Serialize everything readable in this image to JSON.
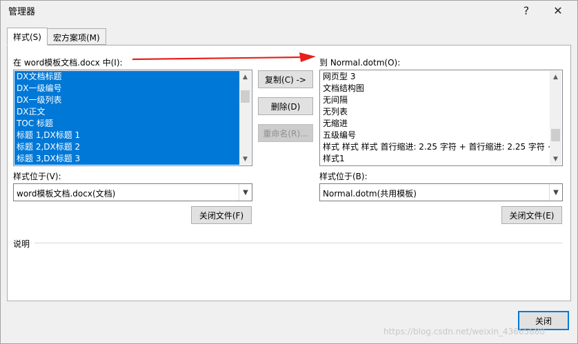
{
  "dialog": {
    "title": "管理器",
    "help": "?",
    "close": "✕"
  },
  "tabs": [
    {
      "label": "样式(S)"
    },
    {
      "label": "宏方案项(M)"
    }
  ],
  "left": {
    "from_label": "在 word模板文档.docx 中(I):",
    "items": [
      "DX文档标题",
      "DX一级编号",
      "DX一级列表",
      "DX正文",
      "TOC 标题",
      "标题 1,DX标题 1",
      "标题 2,DX标题 2",
      "标题 3,DX标题 3"
    ],
    "location_label": "样式位于(V):",
    "location_value": "word模板文档.docx(文档)",
    "close_file": "关闭文件(F)"
  },
  "right": {
    "to_label": "到 Normal.dotm(O):",
    "items": [
      "网页型 3",
      "文档结构图",
      "无间隔",
      "无列表",
      "无缩进",
      "五级编号",
      "样式 样式 样式 首行缩进:  2.25 字符 + 首行缩进:  2.25 字符 +",
      "样式1"
    ],
    "location_label": "样式位于(B):",
    "location_value": "Normal.dotm(共用模板)",
    "close_file": "关闭文件(E)"
  },
  "middle": {
    "copy": "复制(C) ->",
    "delete": "删除(D)",
    "rename": "重命名(R)..."
  },
  "description_label": "说明",
  "footer": {
    "close": "关闭"
  },
  "watermark": "https://blog.csdn.net/weixin_43665680",
  "colors": {
    "selection": "#0078d7",
    "arrow": "#e8201a",
    "focus_border": "#0078d7"
  }
}
